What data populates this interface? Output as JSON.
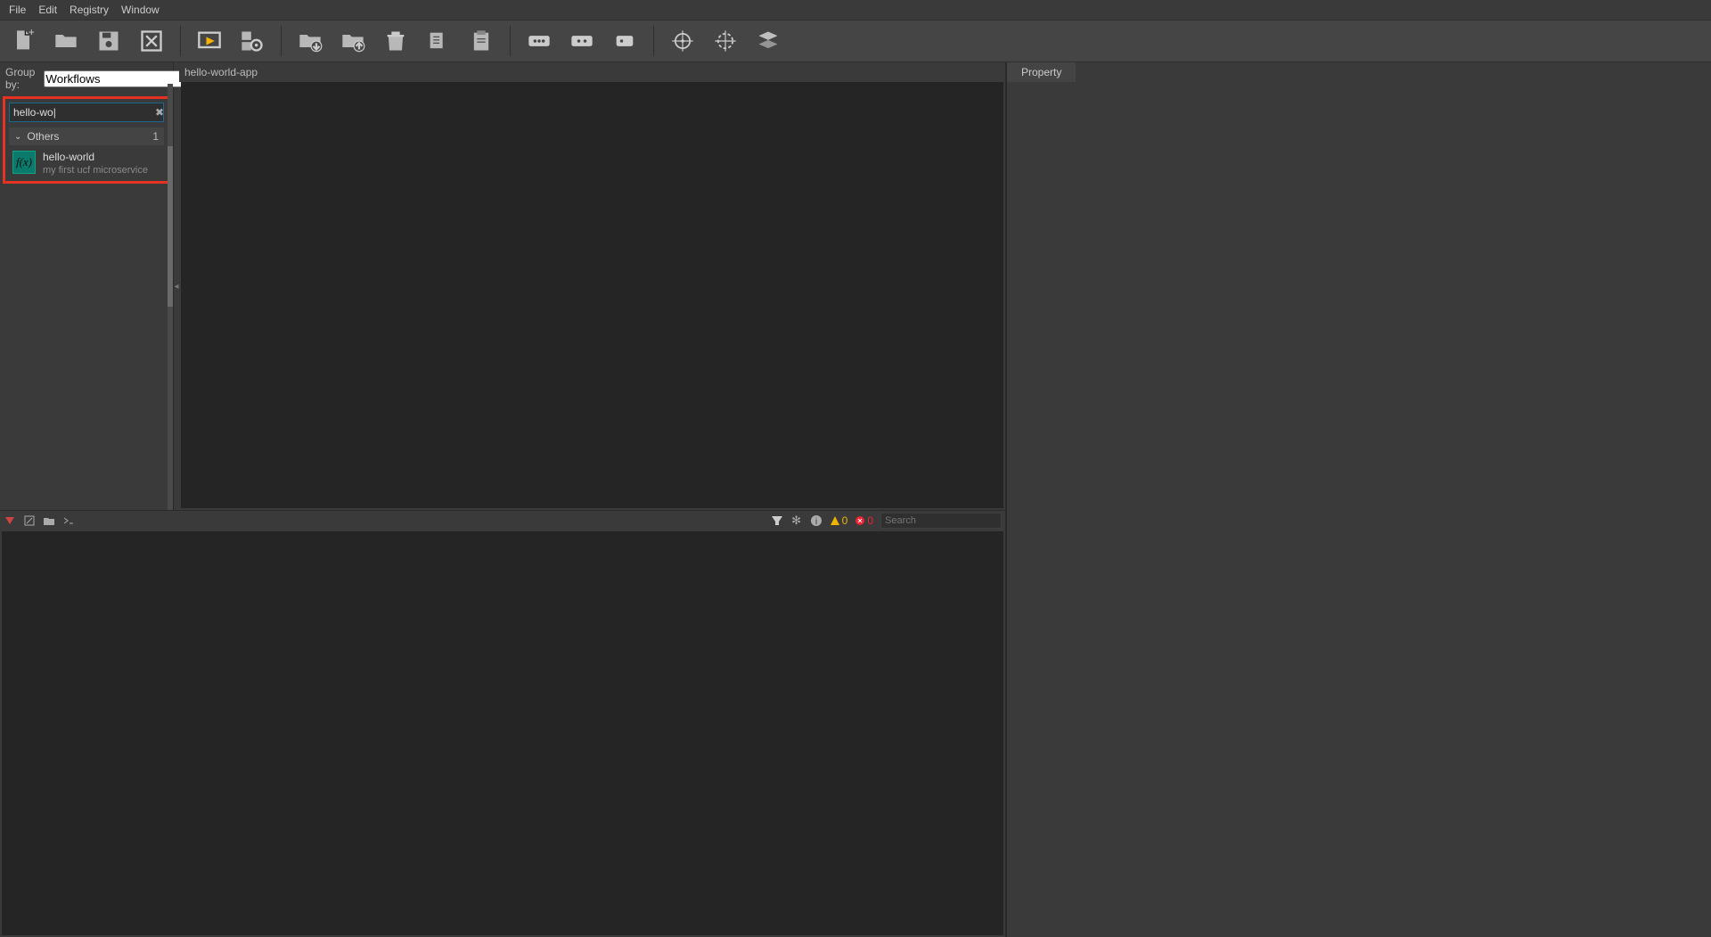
{
  "menu": {
    "items": [
      "File",
      "Edit",
      "Registry",
      "Window"
    ]
  },
  "group_by": {
    "label": "Group by:",
    "selected": "Workflows"
  },
  "search": {
    "value": "hello-wo|"
  },
  "category": {
    "name": "Others",
    "count": "1"
  },
  "result": {
    "icon_label": "f(x)",
    "name": "hello-world",
    "desc": "my first ucf microservice"
  },
  "canvas_tab": "hello-world-app",
  "log": {
    "warn_count": "0",
    "err_count": "0",
    "search_placeholder": "Search"
  },
  "property_tab": "Property"
}
